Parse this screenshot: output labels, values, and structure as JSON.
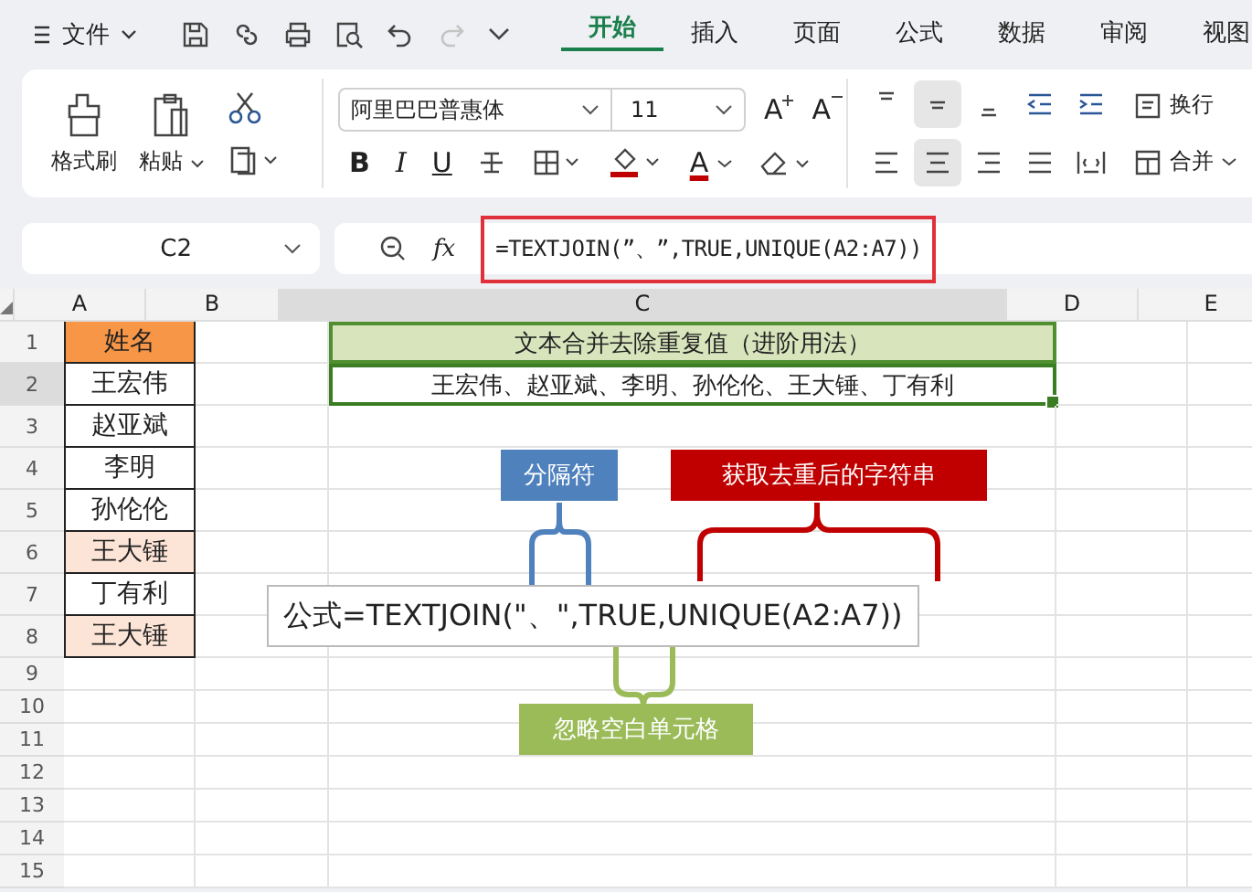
{
  "menu": {
    "label": "文件"
  },
  "quick_access": {
    "redo_disabled": true
  },
  "tabs": [
    {
      "label": "开始",
      "selected": true
    },
    {
      "label": "插入",
      "selected": false
    },
    {
      "label": "页面",
      "selected": false
    },
    {
      "label": "公式",
      "selected": false
    },
    {
      "label": "数据",
      "selected": false
    },
    {
      "label": "审阅",
      "selected": false
    },
    {
      "label": "视图",
      "selected": false
    }
  ],
  "ribbon": {
    "format_painter": "格式刷",
    "paste": "粘贴",
    "font": {
      "name": "阿里巴巴普惠体",
      "size": "11",
      "grow": "A",
      "shrink": "A",
      "bold": "B",
      "italic": "I",
      "underline": "U",
      "color_letter": "A"
    },
    "align_buttons": [
      {
        "kind": "top",
        "selected": false
      },
      {
        "kind": "middle",
        "selected": true
      },
      {
        "kind": "bottom",
        "selected": false
      },
      {
        "kind": "outdent",
        "selected": false
      },
      {
        "kind": "indent",
        "selected": false
      },
      {
        "kind": "left",
        "selected": false
      },
      {
        "kind": "center",
        "selected": true
      },
      {
        "kind": "right",
        "selected": false
      },
      {
        "kind": "justify",
        "selected": false
      },
      {
        "kind": "distributed",
        "selected": false
      }
    ],
    "wrap": "换行",
    "merge": "合并"
  },
  "formula_bar": {
    "cell_ref": "C2",
    "fx_label": "fx",
    "formula": "=TEXTJOIN(”、”,TRUE,UNIQUE(A2:A7))"
  },
  "sheet": {
    "columns": [
      {
        "label": "A",
        "selected": false
      },
      {
        "label": "B",
        "selected": false
      },
      {
        "label": "C",
        "selected": true
      },
      {
        "label": "D",
        "selected": false
      },
      {
        "label": "E",
        "selected": false
      }
    ],
    "rows": [
      {
        "number": "1",
        "selected": false,
        "a": {
          "text": "姓名",
          "color": "#f79646"
        },
        "c": {
          "text": "文本合并去除重复值（进阶用法）",
          "color": "#d8e4bc",
          "active": false
        }
      },
      {
        "number": "2",
        "selected": true,
        "a": {
          "text": "王宏伟"
        },
        "c": {
          "text": "王宏伟、赵亚斌、李明、孙伦伦、王大锤、丁有利",
          "active": true
        }
      },
      {
        "number": "3",
        "selected": false,
        "a": {
          "text": "赵亚斌"
        }
      },
      {
        "number": "4",
        "selected": false,
        "a": {
          "text": "李明"
        }
      },
      {
        "number": "5",
        "selected": false,
        "a": {
          "text": "孙伦伦"
        }
      },
      {
        "number": "6",
        "selected": false,
        "a": {
          "text": "王大锤",
          "color": "#fce4d6"
        }
      },
      {
        "number": "7",
        "selected": false,
        "a": {
          "text": "丁有利"
        }
      },
      {
        "number": "8",
        "selected": false,
        "a": {
          "text": "王大锤",
          "color": "#fce4d6"
        }
      },
      {
        "number": "9",
        "selected": false
      },
      {
        "number": "10",
        "selected": false
      },
      {
        "number": "11",
        "selected": false
      },
      {
        "number": "12",
        "selected": false
      },
      {
        "number": "13",
        "selected": false
      },
      {
        "number": "14",
        "selected": false
      },
      {
        "number": "15",
        "selected": false
      }
    ]
  },
  "annotation": {
    "formula": "公式=TEXTJOIN(\"、\",TRUE,UNIQUE(A2:A7))",
    "labels": [
      {
        "text": "分隔符",
        "color": "#4f81bd"
      },
      {
        "text": "获取去重后的字符串",
        "color": "#c00000"
      },
      {
        "text": "忽略空白单元格",
        "color": "#9bbb59"
      }
    ]
  }
}
